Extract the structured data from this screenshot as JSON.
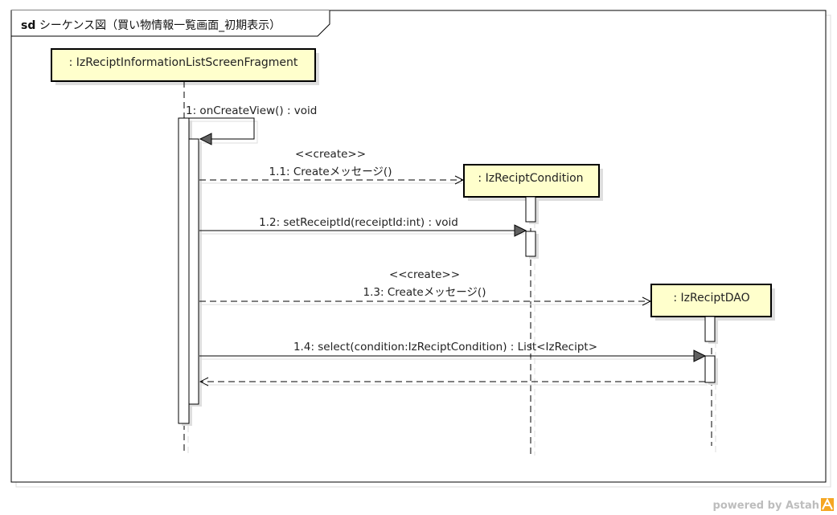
{
  "frame": {
    "keyword": "sd",
    "title": "シーケンス図（買い物情報一覧画面_初期表示）"
  },
  "lifelines": [
    {
      "id": "fragment",
      "label": ": IzReciptInformationListScreenFragment"
    },
    {
      "id": "condition",
      "label": ": IzReciptCondition"
    },
    {
      "id": "dao",
      "label": ": IzReciptDAO"
    }
  ],
  "messages": [
    {
      "id": "m1",
      "label": "1: onCreateView() : void",
      "stereotype": ""
    },
    {
      "id": "m11",
      "label": "1.1: Createメッセージ()",
      "stereotype": "<<create>>"
    },
    {
      "id": "m12",
      "label": "1.2: setReceiptId(receiptId:int) : void",
      "stereotype": ""
    },
    {
      "id": "m13",
      "label": "1.3: Createメッセージ()",
      "stereotype": "<<create>>"
    },
    {
      "id": "m14",
      "label": "1.4: select(condition:IzReciptCondition) : List<IzRecipt>",
      "stereotype": ""
    }
  ],
  "watermark": {
    "text": "powered by Astah",
    "accent_color": "#f5a623"
  },
  "colors": {
    "lifeline_fill": "#ffffcc",
    "stroke": "#000000",
    "shadow": "#cfcfcf",
    "arrowhead": "#606060"
  }
}
